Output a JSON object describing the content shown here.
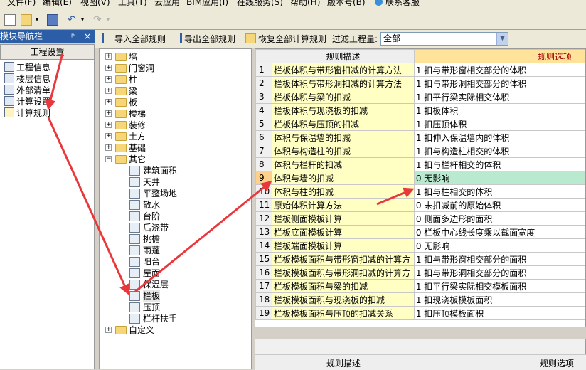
{
  "menu": [
    "文件(F)",
    "编辑(E)",
    "视图(V)",
    "工具(T)",
    "云应用",
    "BIM应用(I)",
    "在线服务(S)",
    "帮助(H)",
    "版本号(B)",
    "联系客服"
  ],
  "nav": {
    "title": "模块导航栏",
    "pin": "ᵖ",
    "close": "×",
    "tab": "工程设置",
    "items": [
      "工程信息",
      "楼层信息",
      "外部清单",
      "计算设置",
      "计算规则"
    ]
  },
  "strip": {
    "import_label": "导入全部规则",
    "export_label": "导出全部规则",
    "restore_label": "恢复全部计算规则",
    "filter_label": "过滤工程量:",
    "filter_value": "全部"
  },
  "tree": {
    "top": [
      "墙",
      "门窗洞",
      "柱",
      "梁",
      "板",
      "楼梯",
      "装修",
      "土方",
      "基础",
      "其它"
    ],
    "children": [
      "建筑面积",
      "天井",
      "平整场地",
      "散水",
      "台阶",
      "后浇带",
      "挑檐",
      "雨蓬",
      "阳台",
      "屋面",
      "保温层",
      "栏板",
      "压顶",
      "栏杆扶手"
    ],
    "last": "自定义"
  },
  "grid": {
    "col_desc": "规则描述",
    "col_opt": "规则选项",
    "rows": [
      {
        "n": "1",
        "desc": "栏板体积与带形窗扣减的计算方法",
        "val": "1 扣与带形窗相交部分的体积"
      },
      {
        "n": "2",
        "desc": "栏板体积与带形洞扣减的计算方法",
        "val": "1 扣与带形洞相交部分的体积"
      },
      {
        "n": "3",
        "desc": "栏板体积与梁的扣减",
        "val": "1 扣平行梁实际相交体积"
      },
      {
        "n": "4",
        "desc": "栏板体积与现浇板的扣减",
        "val": "1 扣板体积"
      },
      {
        "n": "5",
        "desc": "栏板体积与压顶的扣减",
        "val": "1 扣压顶体积"
      },
      {
        "n": "6",
        "desc": "体积与保温墙的扣减",
        "val": "1 扣伸入保温墙内的体积"
      },
      {
        "n": "7",
        "desc": "体积与构造柱的扣减",
        "val": "1 扣与构造柱相交的体积"
      },
      {
        "n": "8",
        "desc": "体积与栏杆的扣减",
        "val": "1 扣与栏杆相交的体积"
      },
      {
        "n": "9",
        "desc": "体积与墙的扣减",
        "val": "0   无影响"
      },
      {
        "n": "10",
        "desc": "体积与柱的扣减",
        "val": "1 扣与柱相交的体积"
      },
      {
        "n": "11",
        "desc": "原始体积计算方法",
        "val": "0 未扣减前的原始体积"
      },
      {
        "n": "12",
        "desc": "栏板侧面模板计算",
        "val": "0 侧面多边形的面积"
      },
      {
        "n": "13",
        "desc": "栏板底面模板计算",
        "val": "0 栏板中心线长度乘以截面宽度"
      },
      {
        "n": "14",
        "desc": "栏板端面模板计算",
        "val": "0   无影响"
      },
      {
        "n": "15",
        "desc": "栏板模板面积与带形窗扣减的计算方",
        "val": "1 扣与带形窗相交部分的面积"
      },
      {
        "n": "16",
        "desc": "栏板模板面积与带形洞扣减的计算方",
        "val": "1 扣与带形洞相交部分的面积"
      },
      {
        "n": "17",
        "desc": "栏板模板面积与梁的扣减",
        "val": "1   扣平行梁实际相交模板面积"
      },
      {
        "n": "18",
        "desc": "栏板模板面积与现浇板的扣减",
        "val": "1   扣现浇板模板面积"
      },
      {
        "n": "19",
        "desc": "栏板模板面积与压顶的扣减关系",
        "val": "1   扣压顶模板面积"
      }
    ]
  },
  "lower": {
    "col_desc": "规则描述",
    "col_opt": "规则选项"
  },
  "colors": {
    "nav_header": "#2b5ea6",
    "desc_bg": "#ffffc4",
    "opt_header": "#ffe39b",
    "selected_value": "#b9e9cf",
    "arrow": "#e8383c"
  }
}
